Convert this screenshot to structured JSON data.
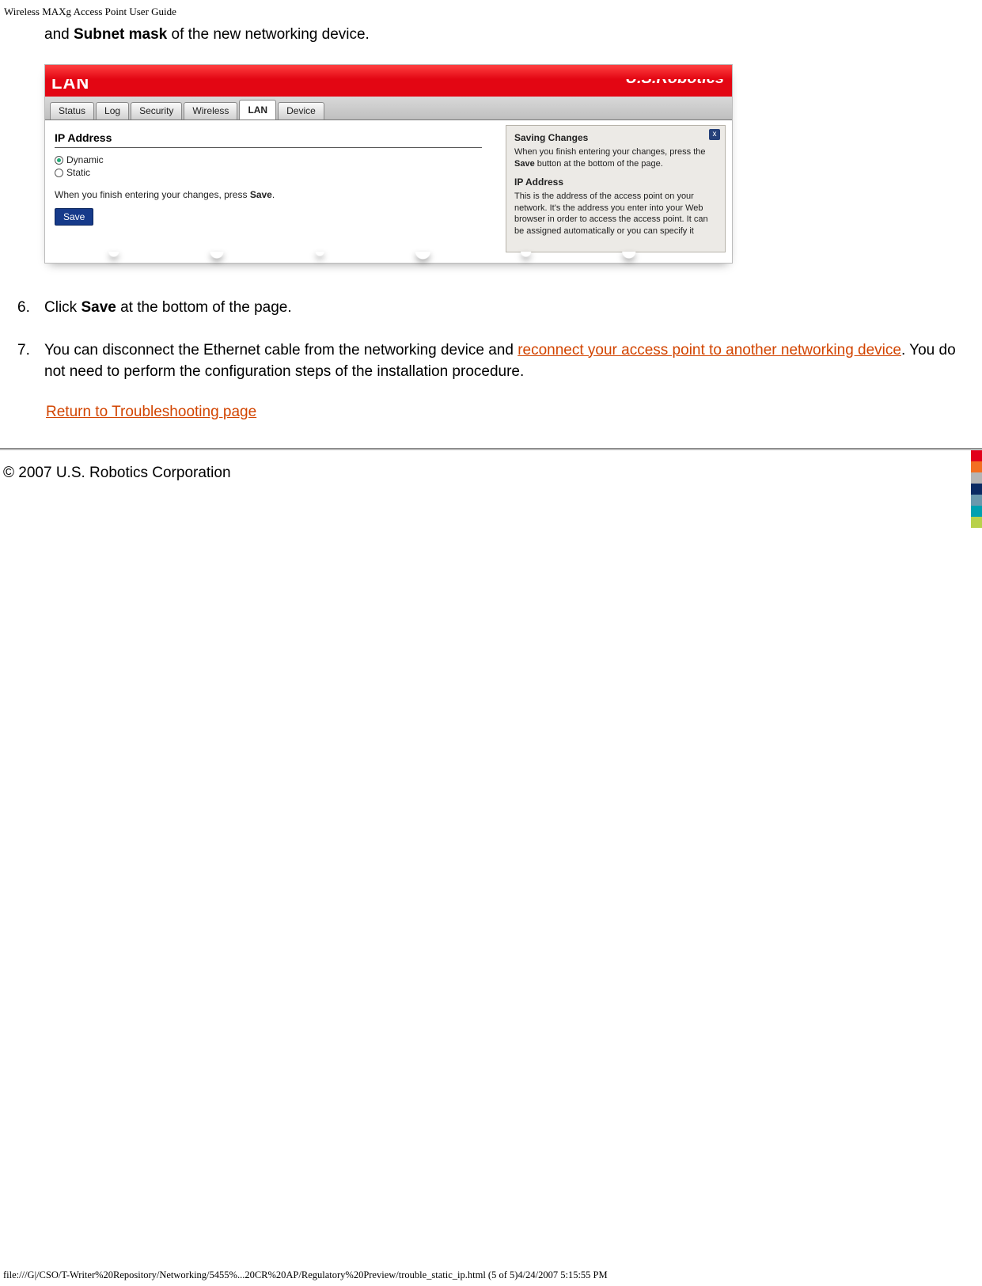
{
  "header": {
    "title": "Wireless MAXg Access Point User Guide"
  },
  "intro": {
    "prefix": "and ",
    "bold": "Subnet mask",
    "suffix": " of the new networking device."
  },
  "router": {
    "title": "LAN",
    "brand": "U.S.Robotics",
    "tabs": [
      "Status",
      "Log",
      "Security",
      "Wireless",
      "LAN",
      "Device"
    ],
    "active_tab": "LAN",
    "section_heading": "IP Address",
    "radios": {
      "dynamic": "Dynamic",
      "static": "Static",
      "selected": "dynamic"
    },
    "finish_text_pre": "When you finish entering your changes, press ",
    "finish_text_bold": "Save",
    "finish_text_post": ".",
    "save_button": "Save",
    "help": {
      "close": "x",
      "h1": "Saving Changes",
      "p1_pre": "When you finish entering your changes, press the ",
      "p1_bold": "Save",
      "p1_post": " button at the bottom of the page.",
      "h2": "IP Address",
      "p2": "This is the address of the access point on your network. It's the address you enter into your Web browser in order to access the access point. It can be assigned automatically or you can specify it"
    }
  },
  "steps": {
    "s6": {
      "num": "6.",
      "pre": "Click ",
      "bold": "Save",
      "post": " at the bottom of the page."
    },
    "s7": {
      "num": "7.",
      "pre": "You can disconnect the Ethernet cable from the networking device and ",
      "link": "reconnect your access point to another networking device",
      "post": ". You do not need to perform the configuration steps of the installation procedure."
    }
  },
  "return_link": "Return to Troubleshooting page",
  "copyright": "© 2007 U.S. Robotics Corporation",
  "strip_colors": [
    "#e2001a",
    "#f36f21",
    "#b5b5b5",
    "#0b2a63",
    "#6a98ad",
    "#00a0b0",
    "#b8d14a"
  ],
  "file_path": "file:///G|/CSO/T-Writer%20Repository/Networking/5455%...20CR%20AP/Regulatory%20Preview/trouble_static_ip.html (5 of 5)4/24/2007 5:15:55 PM"
}
